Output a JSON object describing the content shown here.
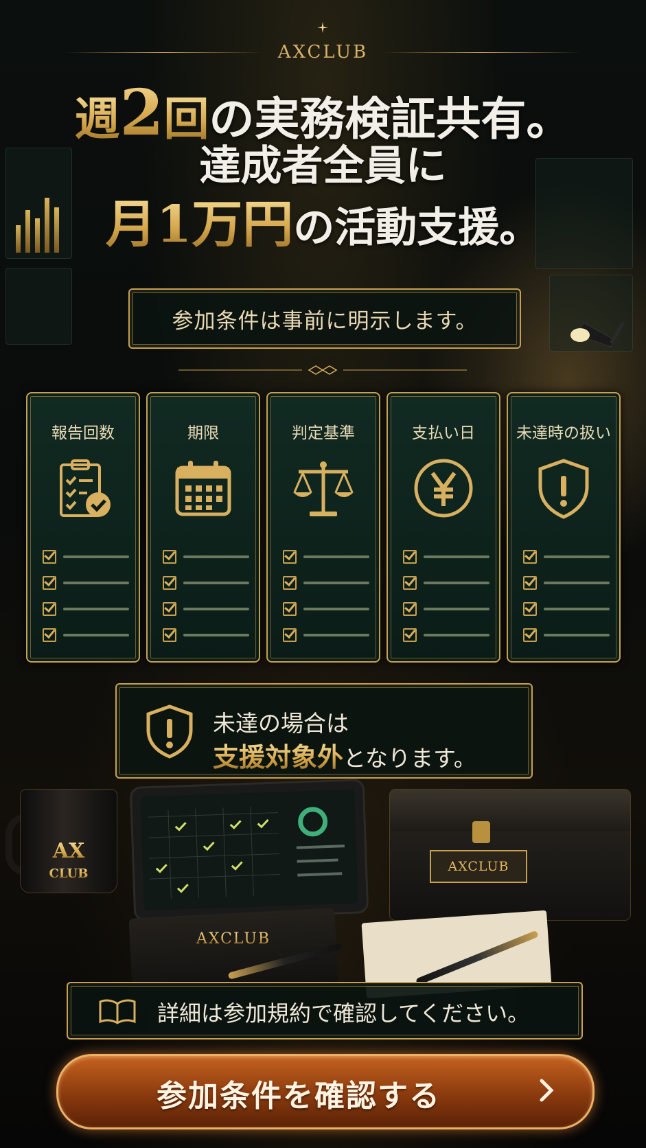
{
  "brand": "AXCLUB",
  "headline": {
    "line1_part1": "週",
    "line1_num": "2",
    "line1_part2": "回",
    "line1_part3": "の実務検証共有。",
    "line2": "達成者全員に",
    "line3_gold": "月1万円",
    "line3_white": "の活動支援。"
  },
  "condition_notice": "参加条件は事前に明示します。",
  "cards": [
    {
      "title": "報告回数",
      "icon": "clipboard-check-icon"
    },
    {
      "title": "期限",
      "icon": "calendar-icon"
    },
    {
      "title": "判定基準",
      "icon": "scales-icon"
    },
    {
      "title": "支払い日",
      "icon": "yen-coin-icon"
    },
    {
      "title": "未達時の扱い",
      "icon": "shield-alert-icon"
    }
  ],
  "warning": {
    "line1": "未達の場合は",
    "line2_emphasis": "支援対象外",
    "line2_rest": "となります。"
  },
  "props": {
    "mug_line1": "AX",
    "mug_line2": "CLUB",
    "box_plate": "AXCLUB",
    "notebook": "AXCLUB"
  },
  "info": "詳細は参加規約で確認してください。",
  "cta": {
    "label": "参加条件を確認する"
  },
  "colors": {
    "gold": "#c9a050",
    "card_bg": "#0b1c17",
    "cta": "#c5621f"
  }
}
